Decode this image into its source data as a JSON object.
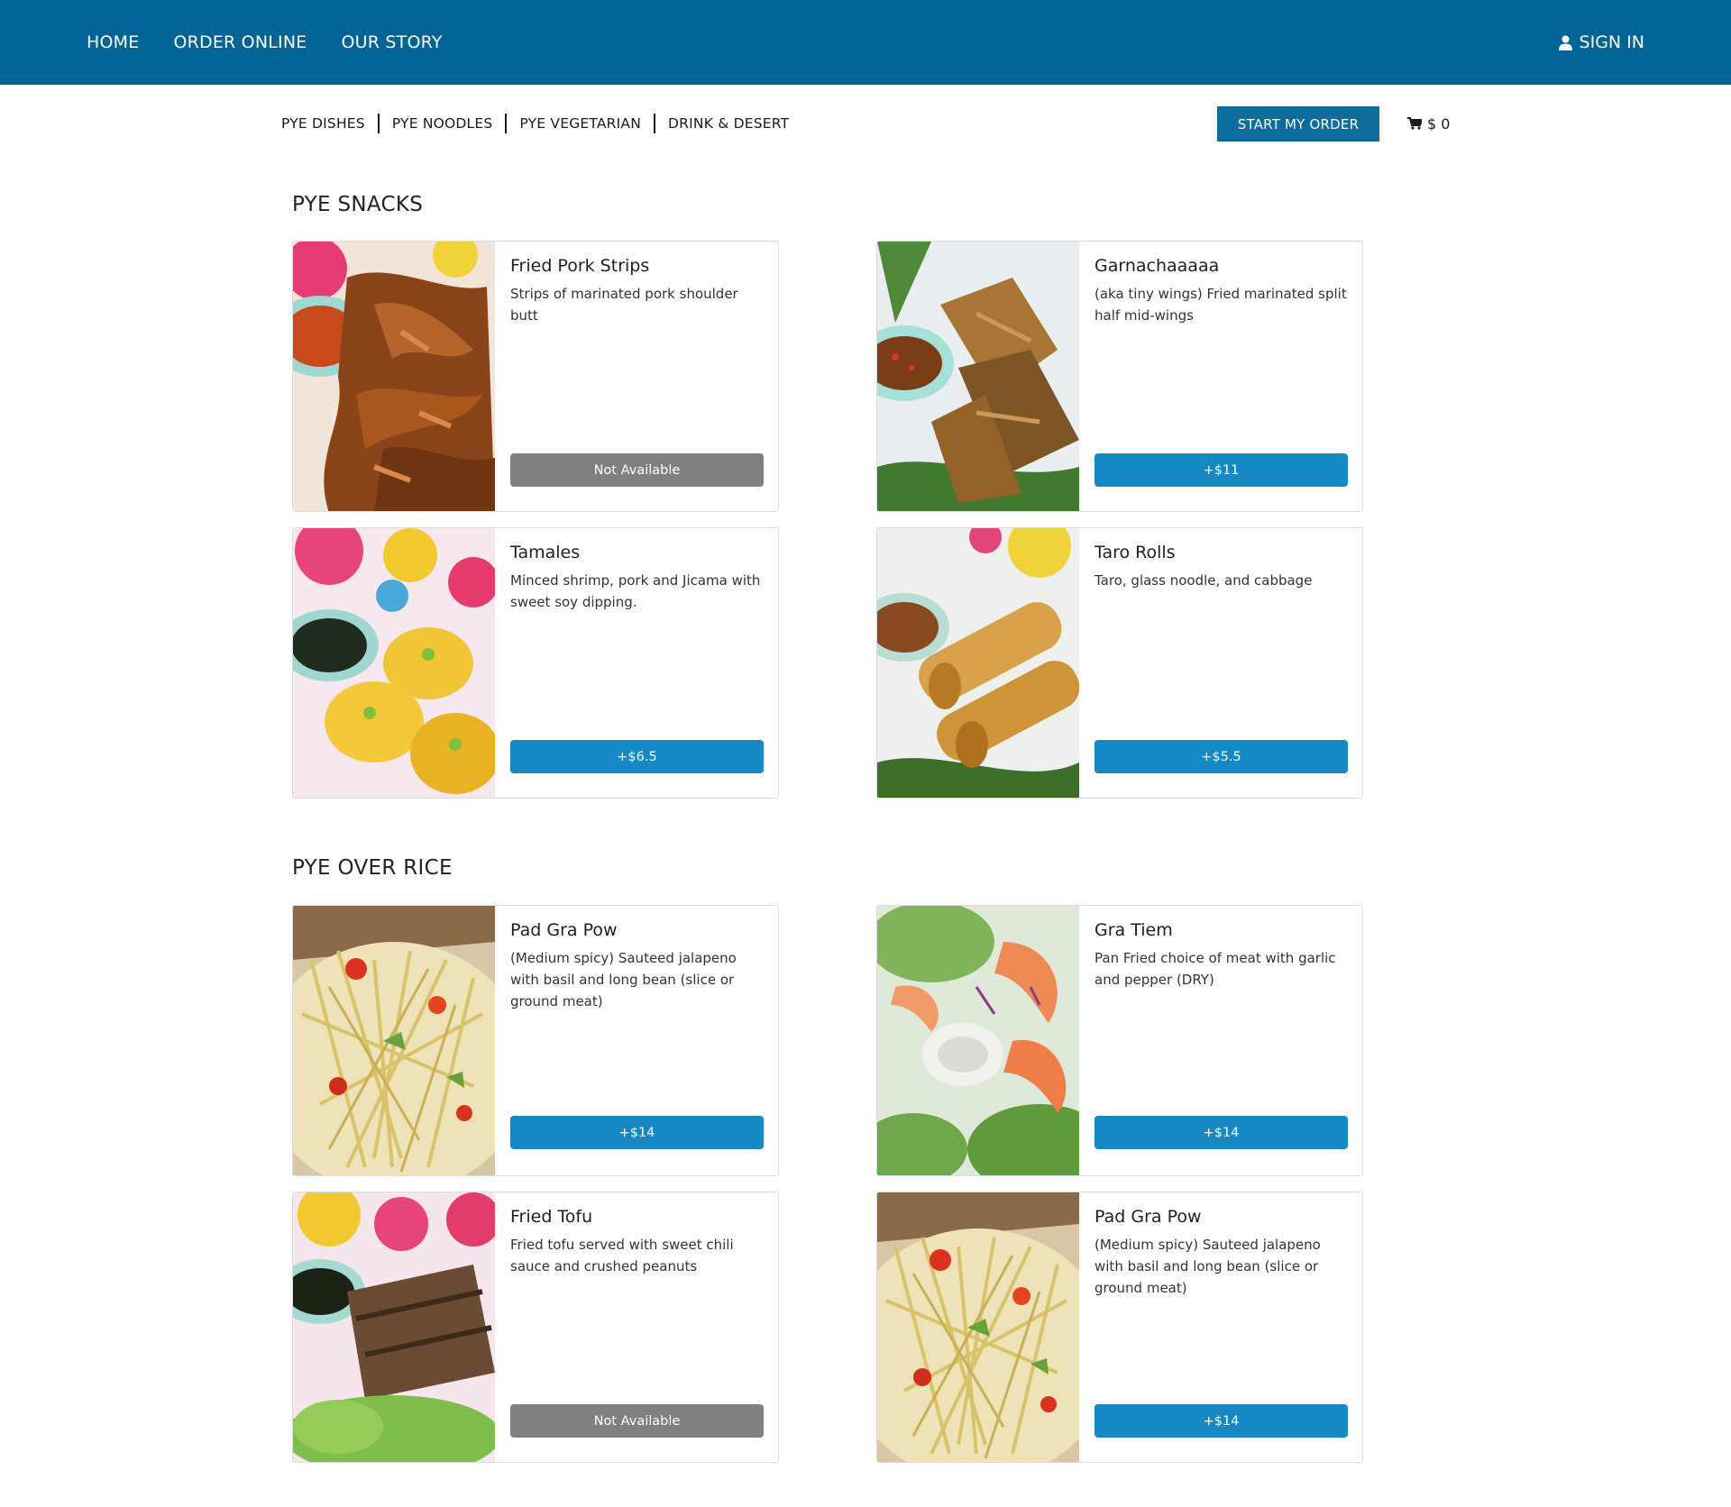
{
  "topnav": {
    "links": [
      "HOME",
      "ORDER ONLINE",
      "OUR STORY"
    ],
    "signin": "SIGN IN"
  },
  "subnav": {
    "categories": [
      "PYE DISHES",
      "PYE NOODLES",
      "PYE VEGETARIAN",
      "DRINK & DESERT"
    ],
    "start_order": "START MY ORDER",
    "cart_total": "$ 0"
  },
  "sections": [
    {
      "title": "PYE SNACKS",
      "items": [
        {
          "name": "Fried Pork Strips",
          "desc": "Strips of marinated pork shoulder butt",
          "button": "Not Available",
          "available": false,
          "image": "fried-pork-strips-photo"
        },
        {
          "name": "Garnachaaaaa",
          "desc": "(aka tiny wings) Fried marinated split half mid-wings",
          "button": "+$11",
          "available": true,
          "image": "garnacha-wings-photo"
        },
        {
          "name": "Tamales",
          "desc": "Minced shrimp, pork and Jicama with sweet soy dipping.",
          "button": "+$6.5",
          "available": true,
          "image": "tamales-photo"
        },
        {
          "name": "Taro Rolls",
          "desc": "Taro, glass noodle, and cabbage",
          "button": "+$5.5",
          "available": true,
          "image": "taro-rolls-photo"
        }
      ]
    },
    {
      "title": "PYE OVER RICE",
      "items": [
        {
          "name": "Pad Gra Pow",
          "desc": "(Medium spicy) Sauteed jalapeno with basil and long bean (slice or ground meat)",
          "button": "+$14",
          "available": true,
          "image": "papaya-salad-photo"
        },
        {
          "name": "Gra Tiem",
          "desc": "Pan Fried choice of meat with garlic and pepper (DRY)",
          "button": "+$14",
          "available": true,
          "image": "shrimp-salad-photo"
        },
        {
          "name": "Fried Tofu",
          "desc": "Fried tofu served with sweet chili sauce and crushed peanuts",
          "button": "Not Available",
          "available": false,
          "image": "grilled-skewers-photo"
        },
        {
          "name": "Pad Gra Pow",
          "desc": "(Medium spicy) Sauteed jalapeno with basil and long bean (slice or ground meat)",
          "button": "+$14",
          "available": true,
          "image": "papaya-salad-photo"
        }
      ]
    }
  ],
  "colors": {
    "header_bg": "#006596",
    "start_button": "#0c6d9c",
    "price_button": "#1689c4",
    "unavailable_button": "#808080"
  }
}
